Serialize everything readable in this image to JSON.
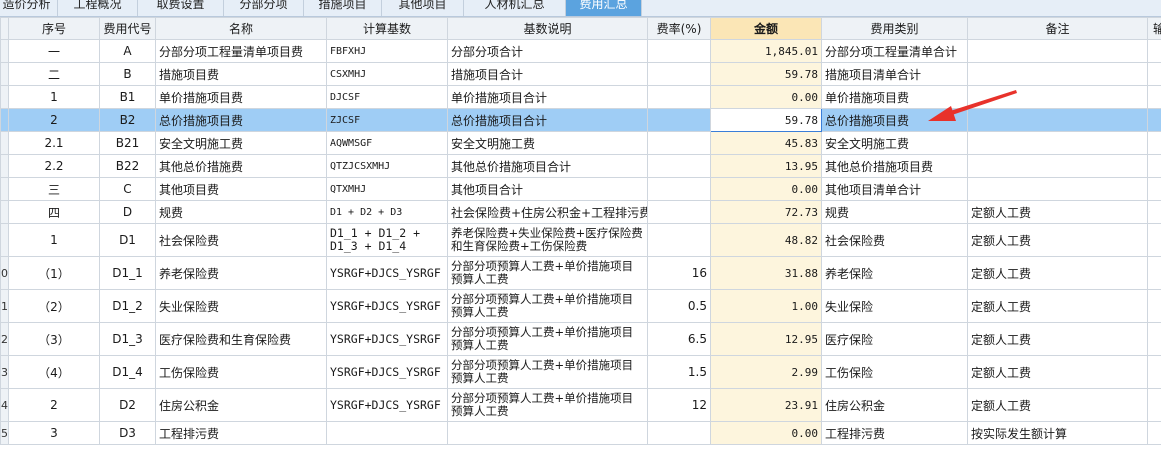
{
  "tabs": [
    "造价分析",
    "工程概况",
    "取费设置",
    "分部分项",
    "措施项目",
    "其他项目",
    "人材机汇总",
    "费用汇总"
  ],
  "active_tab_index": 7,
  "columns": [
    "序号",
    "费用代号",
    "名称",
    "计算基数",
    "基数说明",
    "费率(%)",
    "金额",
    "费用类别",
    "备注",
    "输"
  ],
  "rows": [
    {
      "idx": "",
      "seq": "一",
      "code": "A",
      "name": "分部分项工程量清单项目费",
      "base": "FBFXHJ",
      "desc": "分部分项合计",
      "rate": "",
      "amount": "1,845.01",
      "category": "分部分项工程量清单合计",
      "remark": ""
    },
    {
      "idx": "",
      "seq": "二",
      "code": "B",
      "name": "措施项目费",
      "base": "CSXMHJ",
      "desc": "措施项目合计",
      "rate": "",
      "amount": "59.78",
      "category": "措施项目清单合计",
      "remark": ""
    },
    {
      "idx": "",
      "seq": "1",
      "code": "B1",
      "name": "单价措施项目费",
      "base": "DJCSF",
      "desc": "单价措施项目合计",
      "rate": "",
      "amount": "0.00",
      "category": "单价措施项目费",
      "remark": ""
    },
    {
      "idx": "",
      "seq": "2",
      "code": "B2",
      "name": "总价措施项目费",
      "base": "ZJCSF",
      "desc": "总价措施项目合计",
      "rate": "",
      "amount": "59.78",
      "category": "总价措施项目费",
      "remark": ""
    },
    {
      "idx": "",
      "seq": "2.1",
      "code": "B21",
      "name": "安全文明施工费",
      "base": "AQWMSGF",
      "desc": "安全文明施工费",
      "rate": "",
      "amount": "45.83",
      "category": "安全文明施工费",
      "remark": ""
    },
    {
      "idx": "",
      "seq": "2.2",
      "code": "B22",
      "name": "其他总价措施费",
      "base": "QTZJCSXMHJ",
      "desc": "其他总价措施项目合计",
      "rate": "",
      "amount": "13.95",
      "category": "其他总价措施项目费",
      "remark": ""
    },
    {
      "idx": "",
      "seq": "三",
      "code": "C",
      "name": "其他项目费",
      "base": "QTXMHJ",
      "desc": "其他项目合计",
      "rate": "",
      "amount": "0.00",
      "category": "其他项目清单合计",
      "remark": ""
    },
    {
      "idx": "",
      "seq": "四",
      "code": "D",
      "name": "规费",
      "base": "D1 + D2 + D3",
      "desc": "社会保险费+住房公积金+工程排污费",
      "rate": "",
      "amount": "72.73",
      "category": "规费",
      "remark": "定额人工费"
    },
    {
      "idx": "",
      "seq": "1",
      "code": "D1",
      "name": "社会保险费",
      "base": "D1_1 + D1_2 + D1_3 + D1_4",
      "desc": "养老保险费+失业保险费+医疗保险费和生育保险费+工伤保险费",
      "rate": "",
      "amount": "48.82",
      "category": "社会保险费",
      "remark": "定额人工费"
    },
    {
      "idx": "0",
      "seq": "（1）",
      "code": "D1_1",
      "name": "养老保险费",
      "base": "YSRGF+DJCS_YSRGF",
      "desc": "分部分项预算人工费+单价措施项目预算人工费",
      "rate": "16",
      "amount": "31.88",
      "category": "养老保险",
      "remark": "定额人工费"
    },
    {
      "idx": "1",
      "seq": "（2）",
      "code": "D1_2",
      "name": "失业保险费",
      "base": "YSRGF+DJCS_YSRGF",
      "desc": "分部分项预算人工费+单价措施项目预算人工费",
      "rate": "0.5",
      "amount": "1.00",
      "category": "失业保险",
      "remark": "定额人工费"
    },
    {
      "idx": "2",
      "seq": "（3）",
      "code": "D1_3",
      "name": "医疗保险费和生育保险费",
      "base": "YSRGF+DJCS_YSRGF",
      "desc": "分部分项预算人工费+单价措施项目预算人工费",
      "rate": "6.5",
      "amount": "12.95",
      "category": "医疗保险",
      "remark": "定额人工费"
    },
    {
      "idx": "3",
      "seq": "（4）",
      "code": "D1_4",
      "name": "工伤保险费",
      "base": "YSRGF+DJCS_YSRGF",
      "desc": "分部分项预算人工费+单价措施项目预算人工费",
      "rate": "1.5",
      "amount": "2.99",
      "category": "工伤保险",
      "remark": "定额人工费"
    },
    {
      "idx": "4",
      "seq": "2",
      "code": "D2",
      "name": "住房公积金",
      "base": "YSRGF+DJCS_YSRGF",
      "desc": "分部分项预算人工费+单价措施项目预算人工费",
      "rate": "12",
      "amount": "23.91",
      "category": "住房公积金",
      "remark": "定额人工费"
    },
    {
      "idx": "5",
      "seq": "3",
      "code": "D3",
      "name": "工程排污费",
      "base": "",
      "desc": "",
      "rate": "",
      "amount": "0.00",
      "category": "工程排污费",
      "remark": "按实际发生额计算"
    }
  ],
  "selected_row_index": 3,
  "colors": {
    "accent_tab": "#5ba3df",
    "selected_row": "#9fcdf5",
    "amount_column": "#fdf5dd",
    "arrow": "#e8322b"
  }
}
